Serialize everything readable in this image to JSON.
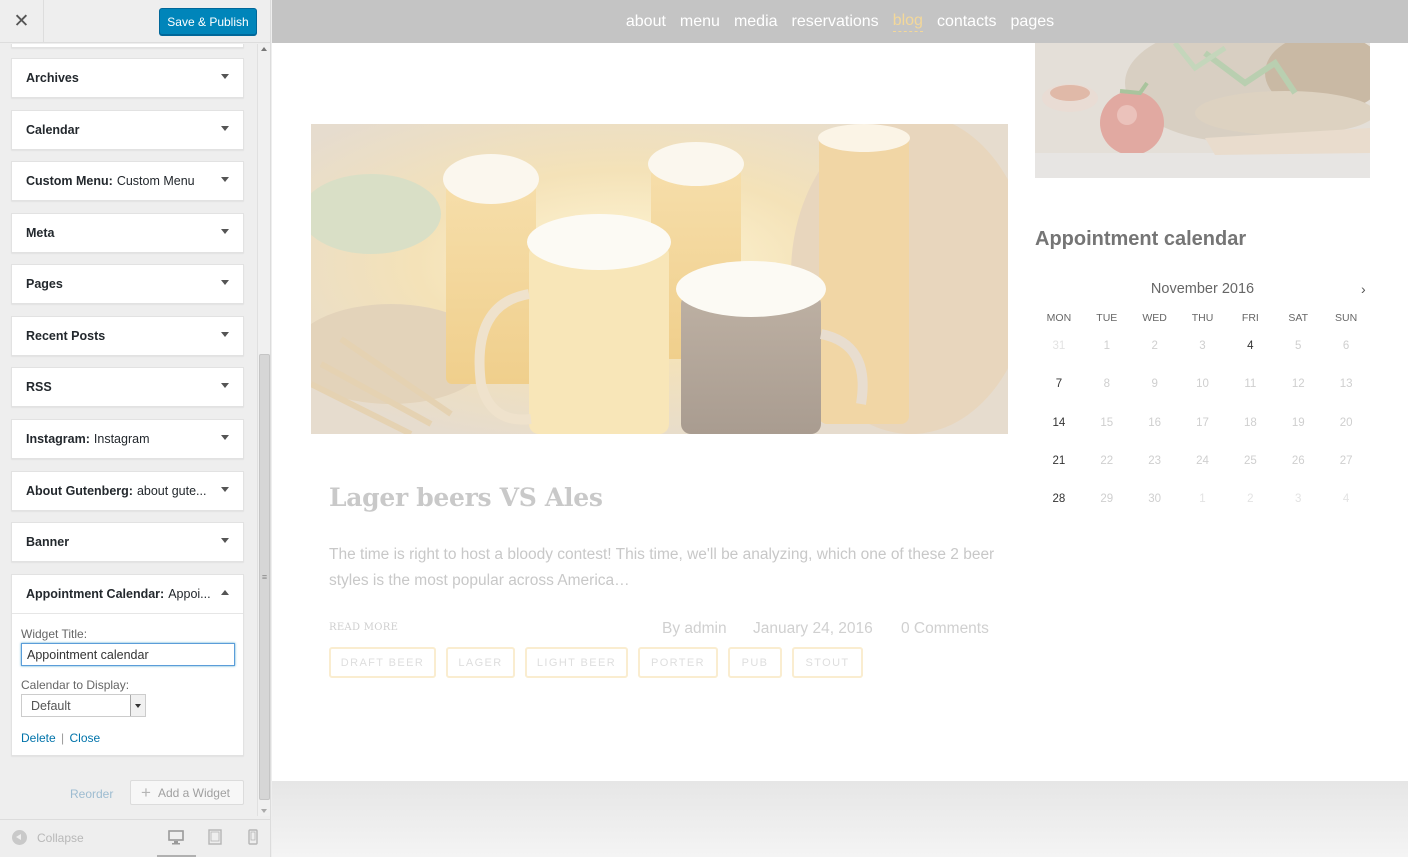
{
  "sidebar": {
    "publish_label": "Save & Publish",
    "close_glyph": "✕",
    "widgets": [
      {
        "title": "Archives",
        "sub": ""
      },
      {
        "title": "Calendar",
        "sub": ""
      },
      {
        "title": "Custom Menu:",
        "sub": "Custom Menu"
      },
      {
        "title": "Meta",
        "sub": ""
      },
      {
        "title": "Pages",
        "sub": ""
      },
      {
        "title": "Recent Posts",
        "sub": ""
      },
      {
        "title": "RSS",
        "sub": ""
      },
      {
        "title": "Instagram:",
        "sub": "Instagram"
      },
      {
        "title": "About Gutenberg:",
        "sub": "about gute..."
      },
      {
        "title": "Banner",
        "sub": ""
      }
    ],
    "open_widget": {
      "title": "Appointment Calendar:",
      "sub": "Appoi...",
      "title_label": "Widget Title:",
      "title_value": "Appointment calendar",
      "calendar_label": "Calendar to Display:",
      "calendar_value": "Default",
      "delete_label": "Delete",
      "separator": "|",
      "close_label": "Close"
    },
    "reorder_label": "Reorder",
    "add_widget_label": "Add a Widget",
    "collapse_label": "Collapse"
  },
  "preview": {
    "nav": [
      "about",
      "menu",
      "media",
      "reservations",
      "blog",
      "contacts",
      "pages"
    ],
    "nav_active": "blog",
    "post": {
      "title": "Lager beers VS Ales",
      "excerpt": "The time is right to host a bloody contest! This time, we'll be analyzing, which one of these 2 beer styles is the most popular across America…",
      "read_more": "READ MORE",
      "author": "By admin",
      "date": "January 24, 2016",
      "comments": "0 Comments",
      "tags": [
        "DRAFT BEER",
        "LAGER",
        "LIGHT BEER",
        "PORTER",
        "PUB",
        "STOUT"
      ]
    },
    "calendar": {
      "title": "Appointment calendar",
      "month": "November 2016",
      "next_glyph": "›",
      "weekdays": [
        "MON",
        "TUE",
        "WED",
        "THU",
        "FRI",
        "SAT",
        "SUN"
      ],
      "weeks": [
        [
          "31",
          "1",
          "2",
          "3",
          "4",
          "5",
          "6"
        ],
        [
          "7",
          "8",
          "9",
          "10",
          "11",
          "12",
          "13"
        ],
        [
          "14",
          "15",
          "16",
          "17",
          "18",
          "19",
          "20"
        ],
        [
          "21",
          "22",
          "23",
          "24",
          "25",
          "26",
          "27"
        ],
        [
          "28",
          "29",
          "30",
          "1",
          "2",
          "3",
          "4"
        ]
      ],
      "available_days": [
        "4",
        "7",
        "14",
        "21",
        "28"
      ]
    }
  }
}
